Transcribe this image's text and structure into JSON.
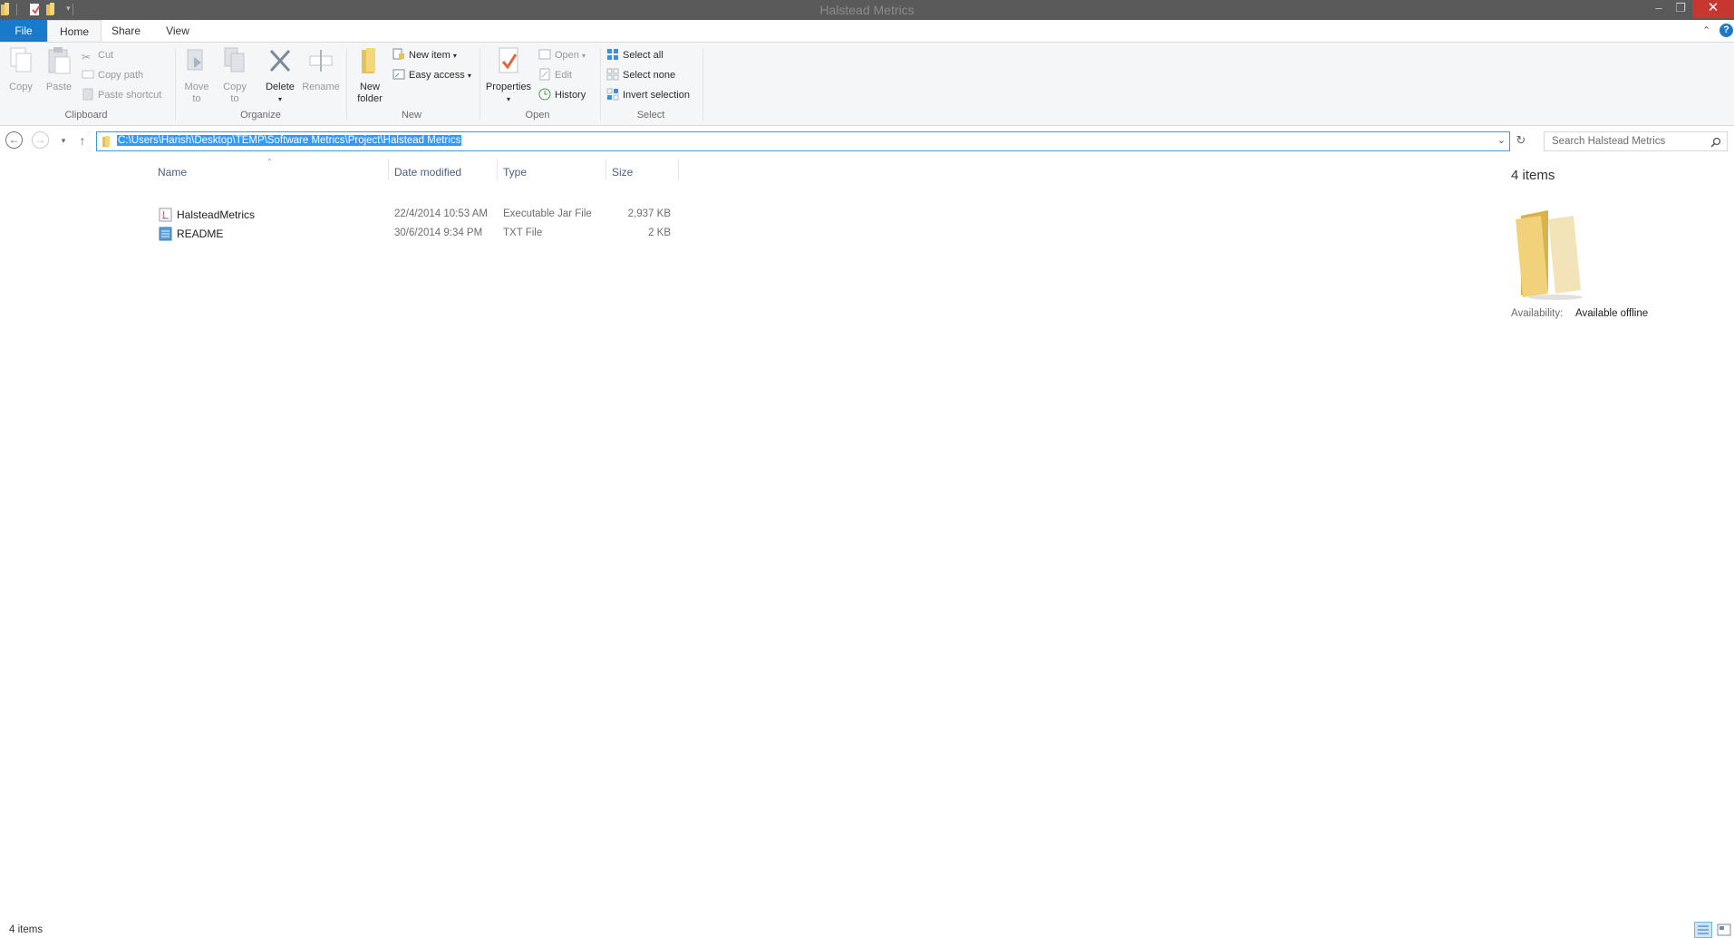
{
  "window": {
    "title": "Halstead Metrics",
    "controls": {
      "minimize": "–",
      "maximize": "❐",
      "close": "✕"
    }
  },
  "ribbon_tabs": {
    "file": "File",
    "home": "Home",
    "share": "Share",
    "view": "View"
  },
  "ribbon": {
    "clipboard": {
      "copy": "Copy",
      "paste": "Paste",
      "cut": "Cut",
      "copy_path": "Copy path",
      "paste_shortcut": "Paste shortcut",
      "label": "Clipboard"
    },
    "organize": {
      "move_to_1": "Move",
      "move_to_2": "to",
      "copy_to_1": "Copy",
      "copy_to_2": "to",
      "delete": "Delete",
      "rename": "Rename",
      "label": "Organize"
    },
    "new": {
      "new_folder_1": "New",
      "new_folder_2": "folder",
      "new_item": "New item",
      "easy_access": "Easy access",
      "label": "New"
    },
    "open": {
      "properties": "Properties",
      "open": "Open",
      "edit": "Edit",
      "history": "History",
      "label": "Open"
    },
    "select": {
      "select_all": "Select all",
      "select_none": "Select none",
      "invert_selection": "Invert selection",
      "label": "Select"
    }
  },
  "address_bar": {
    "path": "C:\\Users\\Harish\\Desktop\\TEMP\\Software Metrics\\Project\\Halstead Metrics"
  },
  "search": {
    "placeholder": "Search Halstead Metrics"
  },
  "columns": {
    "name": "Name",
    "date_modified": "Date modified",
    "type": "Type",
    "size": "Size"
  },
  "files": [
    {
      "name": "HalsteadMetrics",
      "date": "22/4/2014 10:53 AM",
      "type": "Executable Jar File",
      "size": "2,937 KB",
      "icon": "jar-file-icon"
    },
    {
      "name": "README",
      "date": "30/6/2014 9:34 PM",
      "type": "TXT File",
      "size": "2 KB",
      "icon": "text-file-icon"
    }
  ],
  "details": {
    "count": "4 items",
    "availability_label": "Availability:",
    "availability_value": "Available offline"
  },
  "status": {
    "count": "4 items"
  },
  "colors": {
    "accent": "#1979ca",
    "selection": "#3399ff",
    "close": "#c7372f",
    "titlebar": "#5a5a5a"
  }
}
